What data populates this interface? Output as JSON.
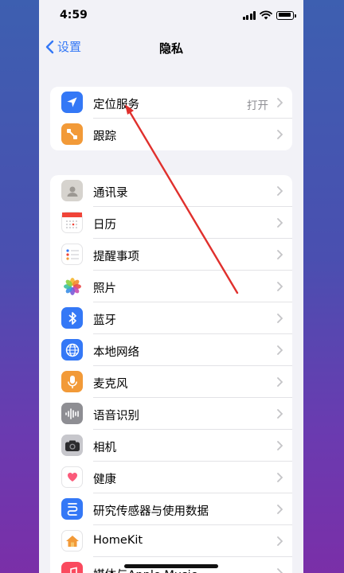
{
  "status_bar": {
    "time": "4:59"
  },
  "nav": {
    "back_label": "设置",
    "title": "隐私"
  },
  "group1": [
    {
      "label": "定位服务",
      "value": "打开",
      "icon": "location-arrow-icon",
      "color": "#3478f6"
    },
    {
      "label": "跟踪",
      "value": "",
      "icon": "tracking-icon",
      "color": "#f29a38"
    }
  ],
  "group2": [
    {
      "label": "通讯录",
      "icon": "contacts-icon",
      "color": "#c9c6c1"
    },
    {
      "label": "日历",
      "icon": "calendar-icon",
      "color": "#ffffff"
    },
    {
      "label": "提醒事项",
      "icon": "reminders-icon",
      "color": "#ffffff"
    },
    {
      "label": "照片",
      "icon": "photos-icon",
      "color": "#ffffff"
    },
    {
      "label": "蓝牙",
      "icon": "bluetooth-icon",
      "color": "#3478f6"
    },
    {
      "label": "本地网络",
      "icon": "globe-icon",
      "color": "#3478f6"
    },
    {
      "label": "麦克风",
      "icon": "microphone-icon",
      "color": "#f29a38"
    },
    {
      "label": "语音识别",
      "icon": "waveform-icon",
      "color": "#8e8e93"
    },
    {
      "label": "相机",
      "icon": "camera-icon",
      "color": "#5a5a5e"
    },
    {
      "label": "健康",
      "icon": "health-heart-icon",
      "color": "#ffffff"
    },
    {
      "label": "研究传感器与使用数据",
      "icon": "research-icon",
      "color": "#3478f6"
    },
    {
      "label": "HomeKit",
      "icon": "home-icon",
      "color": "#ffffff"
    },
    {
      "label": "媒体与Apple Music",
      "icon": "music-icon",
      "color": "#fa4a5e"
    }
  ],
  "annotation": {
    "type": "red-arrow",
    "color": "#e0302d"
  }
}
